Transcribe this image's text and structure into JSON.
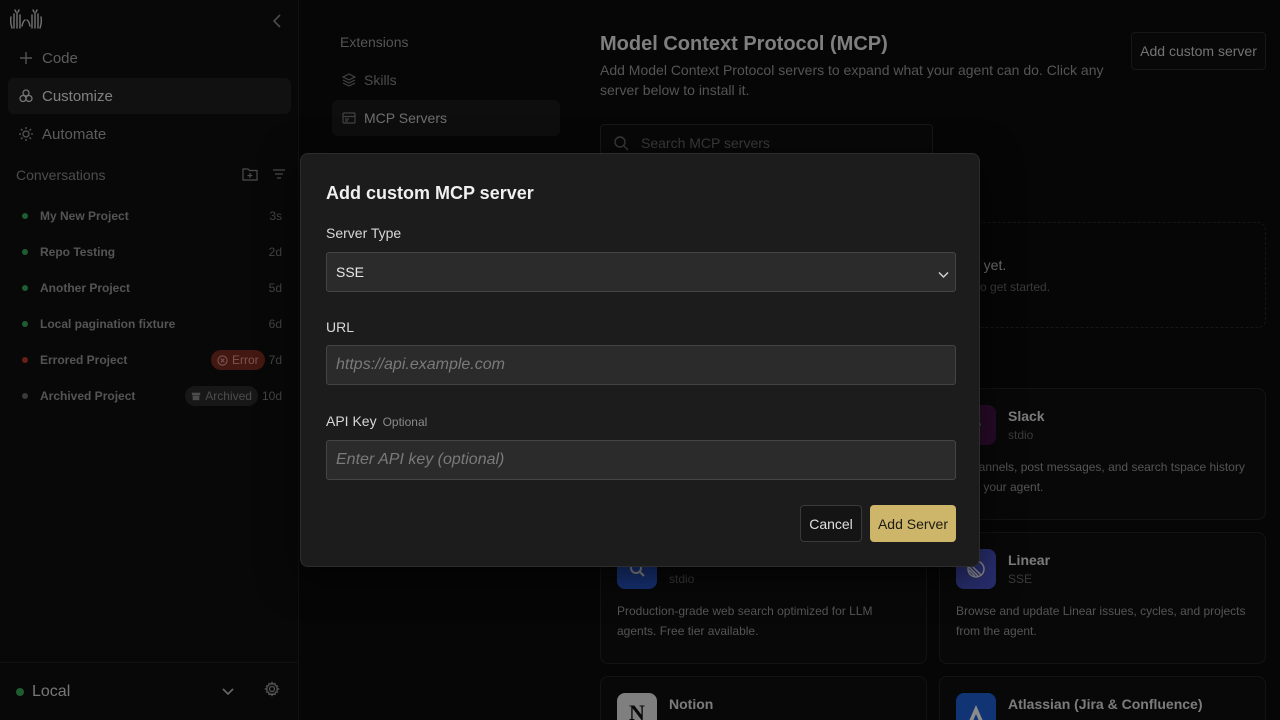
{
  "sidebar": {
    "nav": [
      {
        "label": "Code",
        "icon": "plus-icon"
      },
      {
        "label": "Customize",
        "icon": "customize-icon",
        "active": true
      },
      {
        "label": "Automate",
        "icon": "automate-icon"
      }
    ],
    "conversations_title": "Conversations",
    "conversations": [
      {
        "name": "My New Project",
        "time": "3s",
        "status": "green"
      },
      {
        "name": "Repo Testing",
        "time": "2d",
        "status": "green"
      },
      {
        "name": "Another Project",
        "time": "5d",
        "status": "green"
      },
      {
        "name": "Local pagination fixture",
        "time": "6d",
        "status": "green"
      },
      {
        "name": "Errored Project",
        "time": "7d",
        "status": "red",
        "badge": "Error"
      },
      {
        "name": "Archived Project",
        "time": "10d",
        "status": "gray",
        "badge": "Archived"
      }
    ],
    "footer_label": "Local"
  },
  "extensions": {
    "title": "Extensions",
    "items": [
      {
        "label": "Skills"
      },
      {
        "label": "MCP Servers",
        "active": true
      }
    ]
  },
  "main": {
    "title": "Model Context Protocol (MCP)",
    "description": "Add Model Context Protocol servers to expand what your agent can do. Click any server below to install it.",
    "add_custom_label": "Add custom server",
    "search_placeholder": "Search MCP servers",
    "empty_title": "lled yet.",
    "empty_sub": "ow to get started.",
    "cards": [
      {
        "name": "Slack",
        "type": "stdio",
        "desc": "d channels, post messages, and search tspace history from your agent."
      },
      {
        "name": "",
        "type": "stdio",
        "desc": "Production-grade web search optimized for LLM agents. Free tier available."
      },
      {
        "name": "Linear",
        "type": "SSE",
        "desc": "Browse and update Linear issues, cycles, and projects from the agent."
      },
      {
        "name": "Notion",
        "type": "",
        "desc": ""
      },
      {
        "name": "Atlassian (Jira & Confluence)",
        "type": "",
        "desc": ""
      }
    ]
  },
  "modal": {
    "title": "Add custom MCP server",
    "server_type_label": "Server Type",
    "server_type_value": "SSE",
    "url_label": "URL",
    "url_placeholder": "https://api.example.com",
    "api_key_label": "API Key",
    "api_key_optional": "Optional",
    "api_key_placeholder": "Enter API key (optional)",
    "cancel_label": "Cancel",
    "add_label": "Add Server"
  },
  "colors": {
    "accent": "#cdb56a",
    "status_green": "#3aa857",
    "status_red": "#c0392b",
    "status_gray": "#6a6a6a"
  }
}
